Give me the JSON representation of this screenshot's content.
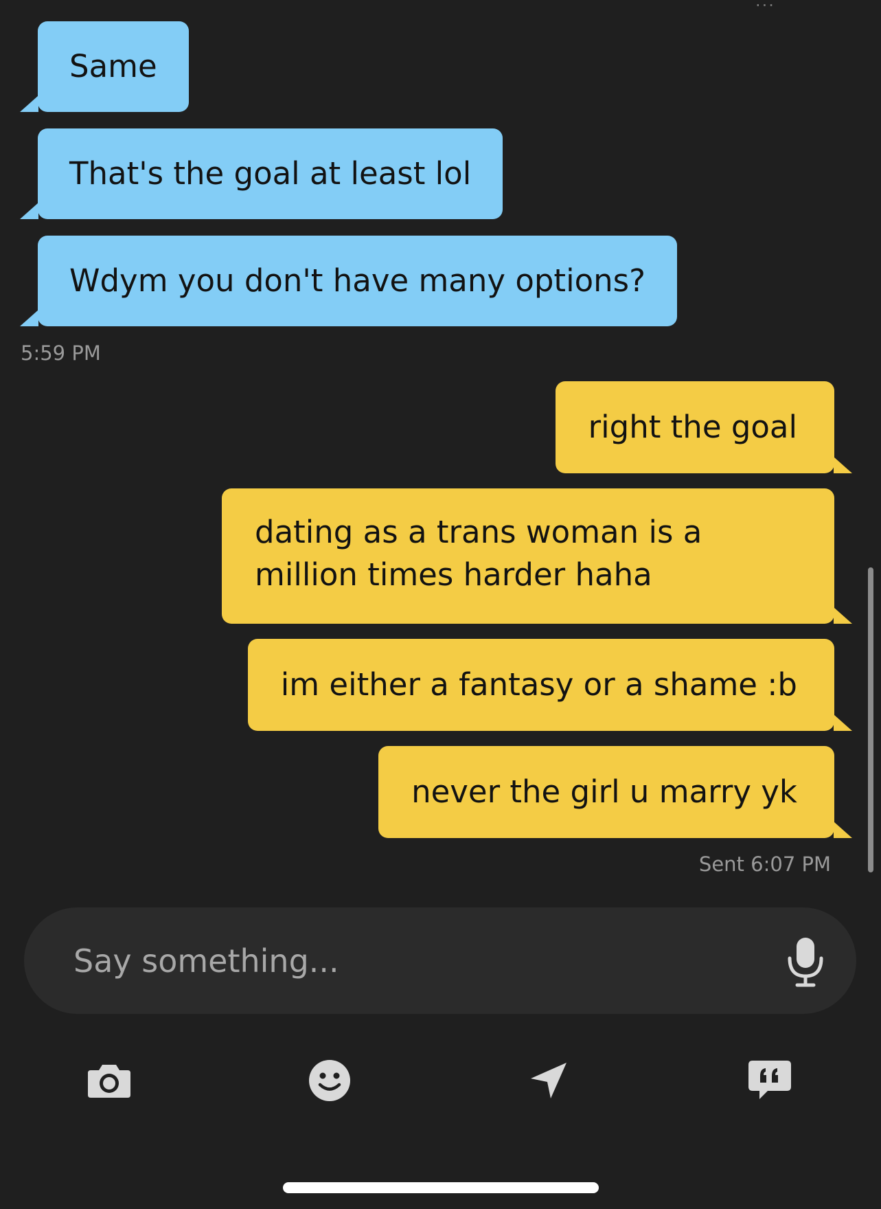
{
  "messages": {
    "received": [
      {
        "text": "Same"
      },
      {
        "text": "That's the goal at least lol"
      },
      {
        "text": "Wdym you don't have many options?"
      }
    ],
    "received_time": "5:59 PM",
    "sent": [
      {
        "text": "right the goal"
      },
      {
        "text": "dating as a trans woman is a million times harder haha"
      },
      {
        "text": "im either a fantasy or a shame :b"
      },
      {
        "text": "never the girl u marry yk"
      }
    ],
    "sent_status": "Sent 6:07 PM"
  },
  "composer": {
    "placeholder": "Say something..."
  },
  "toolbar": {
    "icons": [
      "camera-icon",
      "emoji-icon",
      "location-arrow-icon",
      "quote-bubble-icon"
    ]
  },
  "colors": {
    "background": "#1f1f1f",
    "received_bubble": "#83cdf6",
    "sent_bubble": "#f4cc45",
    "composer": "#2b2b2b",
    "icon": "#d9d9d9"
  }
}
